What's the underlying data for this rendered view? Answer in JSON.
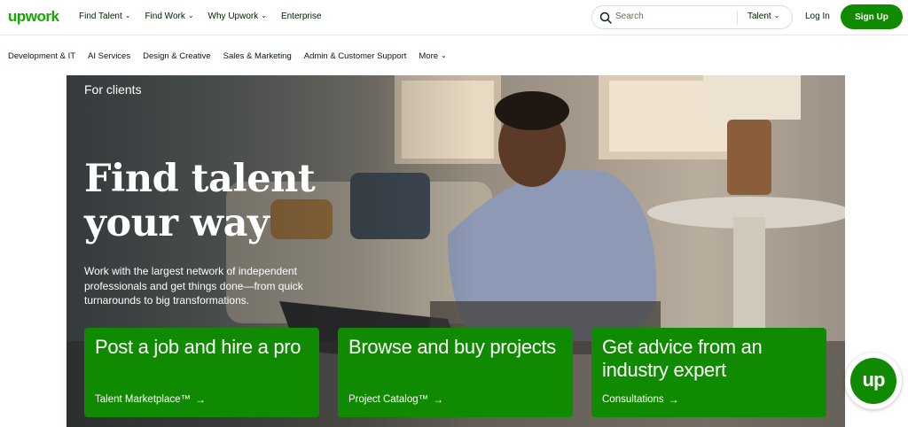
{
  "header": {
    "logo": "upwork",
    "nav": [
      {
        "label": "Find Talent",
        "has_caret": true
      },
      {
        "label": "Find Work",
        "has_caret": true
      },
      {
        "label": "Why Upwork",
        "has_caret": true
      },
      {
        "label": "Enterprise",
        "has_caret": false
      }
    ],
    "search": {
      "placeholder": "Search",
      "type": "Talent",
      "icon": "search-icon"
    },
    "login_label": "Log In",
    "signup_label": "Sign Up"
  },
  "categories": [
    {
      "label": "Development & IT"
    },
    {
      "label": "AI Services"
    },
    {
      "label": "Design & Creative"
    },
    {
      "label": "Sales & Marketing"
    },
    {
      "label": "Admin & Customer Support"
    },
    {
      "label": "More",
      "has_caret": true
    }
  ],
  "hero": {
    "eyebrow": "For clients",
    "title": "Find talent your way",
    "subtitle": "Work with the largest network of independent professionals and get things done—from quick turnarounds to big transformations.",
    "cards": [
      {
        "title": "Post a job and hire a pro",
        "link": "Talent Marketplace™"
      },
      {
        "title": "Browse and buy projects",
        "link": "Project Catalog™"
      },
      {
        "title": "Get advice from an industry expert",
        "link": "Consultations"
      }
    ]
  },
  "badge": {
    "text": "up"
  },
  "colors": {
    "brand": "#108a00",
    "logo": "#14a800",
    "text": "#001e00"
  }
}
